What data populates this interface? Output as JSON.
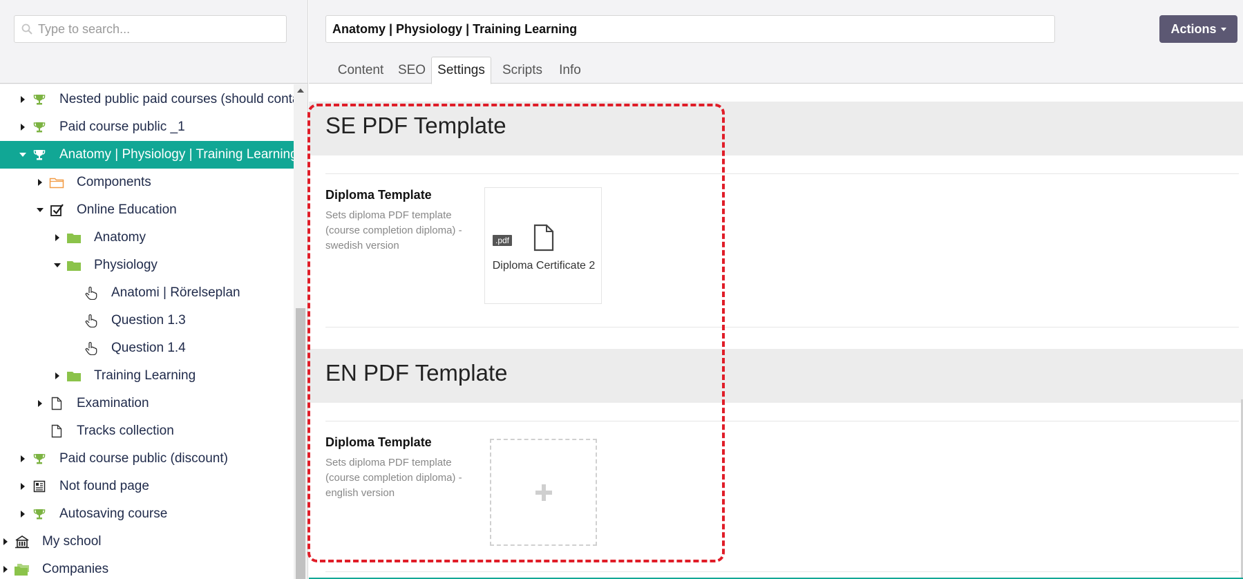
{
  "sidebar": {
    "search": {
      "placeholder": "Type to search..."
    },
    "tree": [
      {
        "label": "Nested public paid courses (should contai",
        "icon": "trophy-icon",
        "expanded": false,
        "selected": false
      },
      {
        "label": "Paid course public _1",
        "icon": "trophy-icon",
        "expanded": false,
        "selected": false
      },
      {
        "label": "Anatomy | Physiology | Training Learning",
        "icon": "trophy-icon",
        "expanded": true,
        "selected": true
      },
      {
        "label": "Components",
        "icon": "folder-outline-icon",
        "expanded": false,
        "selected": false
      },
      {
        "label": "Online Education",
        "icon": "checkbox-checked-icon",
        "expanded": true,
        "selected": false
      },
      {
        "label": "Anatomy",
        "icon": "folder-icon",
        "expanded": false,
        "selected": false
      },
      {
        "label": "Physiology",
        "icon": "folder-icon",
        "expanded": true,
        "selected": false
      },
      {
        "label": "Anatomi | Rörelseplan",
        "icon": "pointer-hand-icon",
        "expanded": null,
        "selected": false
      },
      {
        "label": "Question 1.3",
        "icon": "pointer-hand-icon",
        "expanded": null,
        "selected": false
      },
      {
        "label": "Question 1.4",
        "icon": "pointer-hand-icon",
        "expanded": null,
        "selected": false
      },
      {
        "label": "Training Learning",
        "icon": "folder-icon",
        "expanded": false,
        "selected": false
      },
      {
        "label": "Examination",
        "icon": "document-icon",
        "expanded": false,
        "selected": false
      },
      {
        "label": "Tracks collection",
        "icon": "document-icon",
        "expanded": null,
        "selected": false
      },
      {
        "label": "Paid course public (discount)",
        "icon": "trophy-icon",
        "expanded": false,
        "selected": false
      },
      {
        "label": "Not found page",
        "icon": "newspaper-icon",
        "expanded": false,
        "selected": false
      },
      {
        "label": "Autosaving course",
        "icon": "trophy-icon",
        "expanded": false,
        "selected": false
      },
      {
        "label": "My school",
        "icon": "school-icon",
        "expanded": false,
        "selected": false
      },
      {
        "label": "Companies",
        "icon": "folders-icon",
        "expanded": false,
        "selected": false
      }
    ]
  },
  "header": {
    "title_value": "Anatomy | Physiology | Training Learning",
    "actions_label": "Actions",
    "tabs": [
      {
        "label": "Content",
        "active": false
      },
      {
        "label": "SEO",
        "active": false
      },
      {
        "label": "Settings",
        "active": true
      },
      {
        "label": "Scripts",
        "active": false
      },
      {
        "label": "Info",
        "active": false
      }
    ]
  },
  "settings": {
    "se_section": {
      "title": "SE PDF Template",
      "field_label": "Diploma Template",
      "field_desc": "Sets diploma PDF template (course completion diploma) - swedish version",
      "file": {
        "badge": ".pdf",
        "name": "Diploma Certificate 2"
      }
    },
    "en_section": {
      "title": "EN PDF Template",
      "field_label": "Diploma Template",
      "field_desc": "Sets diploma PDF template (course completion diploma) - english version"
    }
  },
  "colors": {
    "accent": "#11a795",
    "actions_button": "#5c5873",
    "trophy": "#7cb342",
    "folder": "#8bc34a",
    "folder_outline": "#f29b43",
    "highlight": "#e01d28"
  }
}
